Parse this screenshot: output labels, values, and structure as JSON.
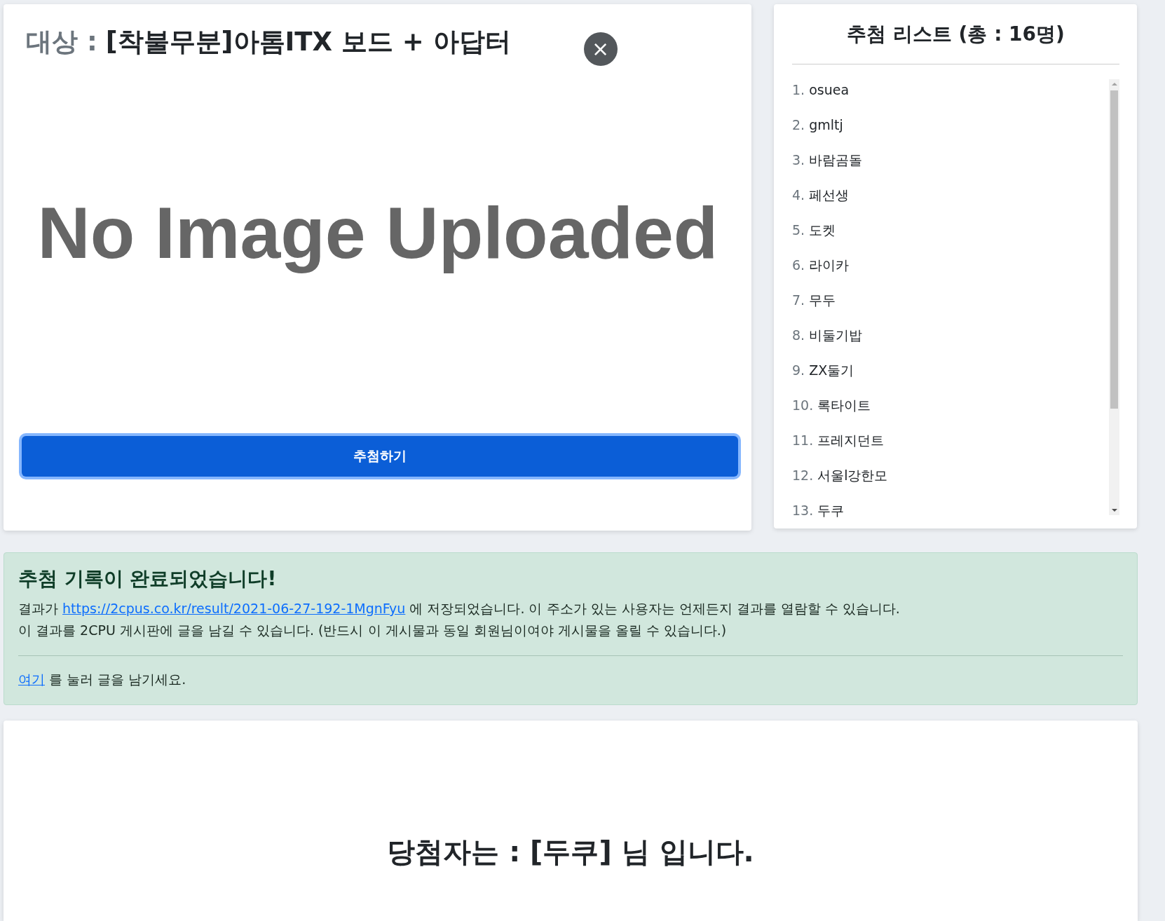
{
  "draw_panel": {
    "title_label": "대상 :",
    "title_value": "[착불무분]아톰ITX 보드 + 아답터",
    "close_icon_text": "×",
    "image_text": "No Image Uploaded",
    "draw_button": "추첨하기"
  },
  "entry_list": {
    "title": "추첨 리스트 (총 : 16명)",
    "items": [
      {
        "number": "1.",
        "name": "osuea"
      },
      {
        "number": "2.",
        "name": "gmltj"
      },
      {
        "number": "3.",
        "name": "바람곰돌"
      },
      {
        "number": "4.",
        "name": "페선생"
      },
      {
        "number": "5.",
        "name": "도켓"
      },
      {
        "number": "6.",
        "name": "라이카"
      },
      {
        "number": "7.",
        "name": "무두"
      },
      {
        "number": "8.",
        "name": "비둘기밥"
      },
      {
        "number": "9.",
        "name": "ZX둘기"
      },
      {
        "number": "10.",
        "name": "록타이트"
      },
      {
        "number": "11.",
        "name": "프레지던트"
      },
      {
        "number": "12.",
        "name": "서울l강한모"
      },
      {
        "number": "13.",
        "name": "두쿠"
      }
    ]
  },
  "alert": {
    "heading": "추첨 기록이 완료되었습니다!",
    "line_1_before": "결과가",
    "link": "https://2cpus.co.kr/result/2021-06-27-192-1MgnFyu",
    "line_1_after": "에 저장되었습니다. 이 주소가 있는 사용자는 언제든지 결과를 열람할 수 있습니다.",
    "line_2": "이 결과를 2CPU 게시판에 글을 남길 수 있습니다. (반드시 이 게시물과 동일 회원님이여야 게시물을 올릴 수 있습니다.)",
    "here_link": "여기",
    "here_after": "를 눌러 글을 남기세요."
  },
  "result": {
    "text": "당첨자는 : [두쿠] 님 입니다."
  }
}
